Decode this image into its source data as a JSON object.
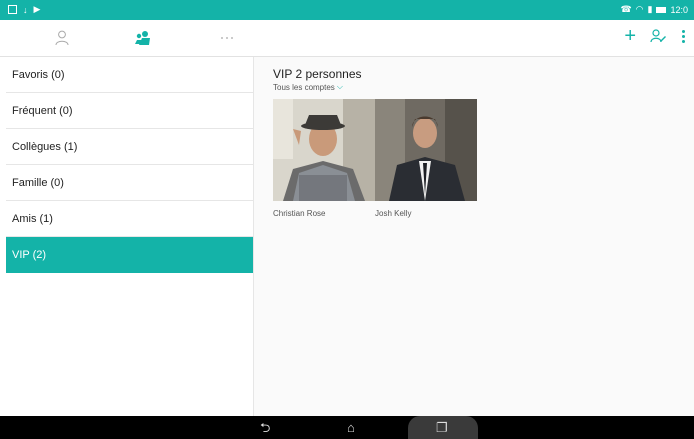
{
  "status_bar": {
    "time": "12:0",
    "bg_color": "#14b3a8"
  },
  "action_bar": {
    "tabs": [
      {
        "icon": "person-icon",
        "active": false
      },
      {
        "icon": "group-icon",
        "active": true
      },
      {
        "icon": "dialpad-icon",
        "active": false
      }
    ],
    "add_label": "+"
  },
  "sidebar": {
    "groups": [
      {
        "label": "Favoris (0)"
      },
      {
        "label": "Fréquent (0)"
      },
      {
        "label": "Collègues (1)"
      },
      {
        "label": "Famille (0)"
      },
      {
        "label": "Amis (1)"
      },
      {
        "label": "VIP (2)"
      }
    ],
    "active_index": 5
  },
  "main": {
    "title": "VIP 2 personnes",
    "account_filter": "Tous les comptes",
    "contacts": [
      {
        "name": "Christian Rose"
      },
      {
        "name": "Josh Kelly"
      }
    ]
  },
  "nav_bar": {
    "back_icon": "back-icon",
    "home_icon": "home-icon",
    "recents_icon": "recents-icon"
  },
  "colors": {
    "accent": "#14b3a8"
  }
}
